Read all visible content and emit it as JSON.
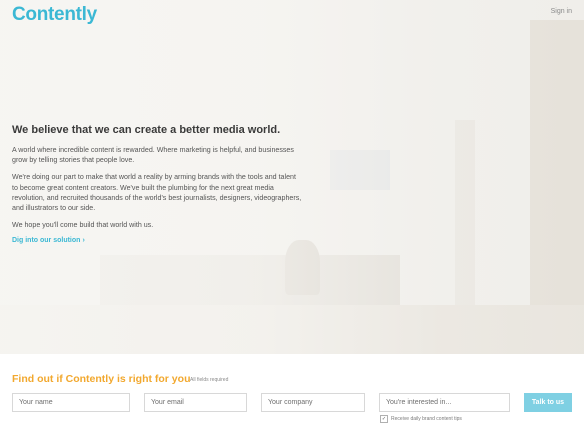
{
  "header": {
    "logo": "Contently",
    "signin": "Sign in"
  },
  "hero": {
    "headline": "We believe that we can create a better media world.",
    "paragraphs": [
      "A world where incredible content is rewarded. Where marketing is helpful, and businesses grow by telling stories that people love.",
      "We're doing our part to make that world a reality by arming brands with the tools and talent to become great content creators. We've built the plumbing for the next great media revolution, and recruited thousands of the world's best journalists, designers, videographers, and illustrators to our side.",
      "We hope you'll come build that world with us."
    ],
    "link": "Dig into our solution",
    "link_icon": "chevron-right-icon"
  },
  "form": {
    "title": "Find out if Contently is right for you",
    "required_note": "All fields required",
    "fields": {
      "name_placeholder": "Your name",
      "email_placeholder": "Your email",
      "company_placeholder": "Your company",
      "interest_placeholder": "You're interested in..."
    },
    "submit": "Talk to us",
    "checkbox_label": "Receive daily brand content tips",
    "checkbox_checked": true
  },
  "colors": {
    "accent": "#3bb8d4",
    "title_orange": "#f2a82e",
    "button": "#7fd0e3"
  }
}
